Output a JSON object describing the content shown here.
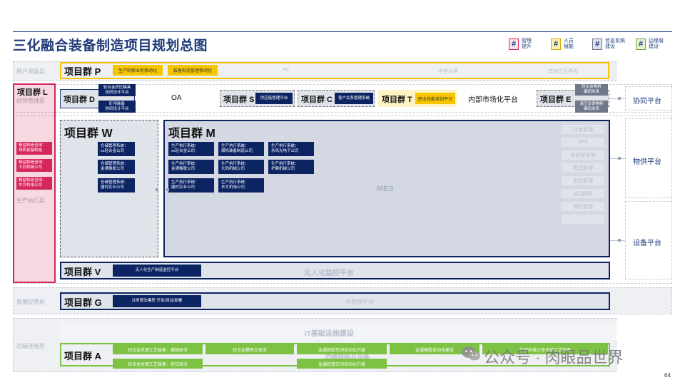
{
  "page": {
    "title": "三化融合装备制造项目规划总图",
    "page_number": "64",
    "watermark": "公众号 · 肉眼品世界"
  },
  "legend": [
    {
      "symbol": "#",
      "color": "#d4275a",
      "line1": "管理",
      "line2": "提升"
    },
    {
      "symbol": "#",
      "color": "#f7c500",
      "line1": "人员",
      "line2": "赋能"
    },
    {
      "symbol": "#",
      "color": "#9aa3b4",
      "line1": "信息系统",
      "line2": "建设"
    },
    {
      "symbol": "#",
      "color": "#7dc243",
      "line1": "边缘层",
      "line2": "建设"
    }
  ],
  "layers": {
    "user": "用户界面层",
    "biz": "经营管理层",
    "exec": "生产执行层",
    "data": "数据应用层",
    "edge": "边缘连接层"
  },
  "platforms": {
    "collab": "协同平台",
    "supply": "物供平台",
    "equip": "设备平台"
  },
  "group_p": {
    "title": "项目群 P",
    "items": [
      "生产制修业务移动化",
      "装备制造管理移动化"
    ],
    "faint": [
      "PC",
      "中控大屏",
      "其他交互界面"
    ]
  },
  "group_l": {
    "title": "项目群 L",
    "items": [
      {
        "line1": "精益制造咨询：",
        "line2": "煤机装备制造"
      },
      {
        "line1": "精益制造咨询：",
        "line2": "大同机械公司"
      },
      {
        "line1": "精益制造咨询：",
        "line2": "东方机电公司"
      }
    ]
  },
  "group_d": {
    "title": "项目群 D",
    "items": [
      {
        "line1": "轻合金挤压模具",
        "line2": "协同设计平台"
      },
      {
        "line1": "矿用装备",
        "line2": "协同设计平台"
      }
    ]
  },
  "oa": "OA",
  "group_s": {
    "title": "项目群 S",
    "item": "供应链管理平台"
  },
  "group_c": {
    "title": "项目群 C",
    "item": "客户关系管理系统"
  },
  "group_t": {
    "title": "项目群 T",
    "item": "职业技能培训平台"
  },
  "internal_market": "内部市场化平台",
  "group_e": {
    "title": "项目群 E",
    "items": [
      {
        "line1": "轻合金物料",
        "line2": "编码体系"
      },
      {
        "line1": "液压支架物料",
        "line2": "编码体系"
      }
    ]
  },
  "group_w": {
    "title": "项目群 W",
    "items": [
      {
        "line1": "仓储管理系统：",
        "line2": "xx轻合金公司"
      },
      {
        "line1": "仓储管理系统：",
        "line2": "金通橡胶公司"
      },
      {
        "line1": "仓储管理系统：",
        "line2": "唐村实业公司"
      }
    ]
  },
  "group_m": {
    "title": "项目群 M",
    "items": [
      {
        "line1": "生产执行系统：",
        "line2": "xx轻合金公司"
      },
      {
        "line1": "生产执行系统：",
        "line2": "煤机装备制造公司"
      },
      {
        "line1": "生产执行系统：",
        "line2": "东风光电子公司"
      },
      {
        "line1": "生产执行系统：",
        "line2": "金通橡胶公司"
      },
      {
        "line1": "生产执行系统：",
        "line2": "大同机械公司"
      },
      {
        "line1": "生产执行系统：",
        "line2": "护翼机械公司"
      },
      {
        "line1": "生产执行系统：",
        "line2": "唐村实业公司"
      },
      {
        "line1": "生产执行系统：",
        "line2": "东方机电公司"
      }
    ],
    "mes": "MES",
    "modules": [
      "订单管理",
      "APS",
      "实验室管理",
      "模具管理",
      "质检管理",
      "自动配料",
      "物料管理",
      "……"
    ]
  },
  "group_v": {
    "title": "项目群 V",
    "item": "无人化生产制造监控平台",
    "faint": "无人化监控平台"
  },
  "group_g": {
    "title": "项目群 G",
    "item": "业务算法模型 开发/测试/部署",
    "faint": "大数据平台"
  },
  "it_infra": "IT基础设施建设",
  "group_a": {
    "title": "项目群 A",
    "items_top": [
      "轻合金关键工艺装备：熔铸部分",
      "轻合金模具立体库",
      "金通炼胶车间自动化升级",
      "金通橡胶自动化建设",
      "矿用机械大修关键工艺装备"
    ],
    "items_bottom": [
      "轻合金关键工艺装备：挤压部分",
      "金通胶管车间自动化升级"
    ],
    "faint": "边缘网络与设备"
  }
}
